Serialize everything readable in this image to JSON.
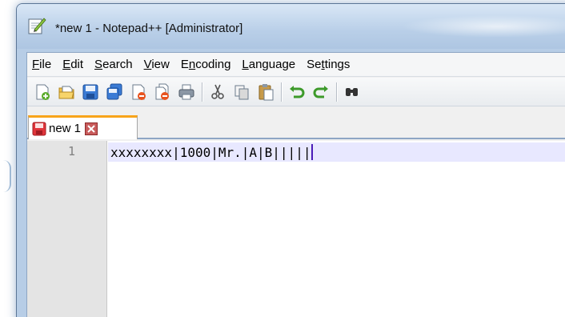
{
  "window": {
    "title": "*new 1 - Notepad++ [Administrator]"
  },
  "menu": {
    "items": [
      {
        "label": "File",
        "underline": "F",
        "rest": "ile"
      },
      {
        "label": "Edit",
        "underline": "E",
        "rest": "dit"
      },
      {
        "label": "Search",
        "underline": "S",
        "rest": "earch"
      },
      {
        "label": "View",
        "underline": "V",
        "rest": "iew"
      },
      {
        "label": "Encoding",
        "pre": "E",
        "underline": "n",
        "rest": "coding"
      },
      {
        "label": "Language",
        "underline": "L",
        "rest": "anguage"
      },
      {
        "label": "Settings",
        "pre": "Se",
        "underline": "t",
        "rest": "tings"
      }
    ]
  },
  "toolbar": {
    "buttons": [
      "new-file-icon",
      "open-file-icon",
      "save-icon",
      "save-all-icon",
      "close-icon",
      "close-all-icon",
      "print-icon",
      "cut-icon",
      "copy-icon",
      "paste-icon",
      "undo-icon",
      "redo-icon",
      "find-icon"
    ]
  },
  "tab": {
    "label": "new 1"
  },
  "editor": {
    "line_number": "1",
    "line_text": "xxxxxxxx|1000|Mr.|A|B|||||"
  },
  "colors": {
    "tab_accent": "#f8a41a",
    "current_line": "#e8e8ff",
    "caret": "#4a1cb8"
  }
}
